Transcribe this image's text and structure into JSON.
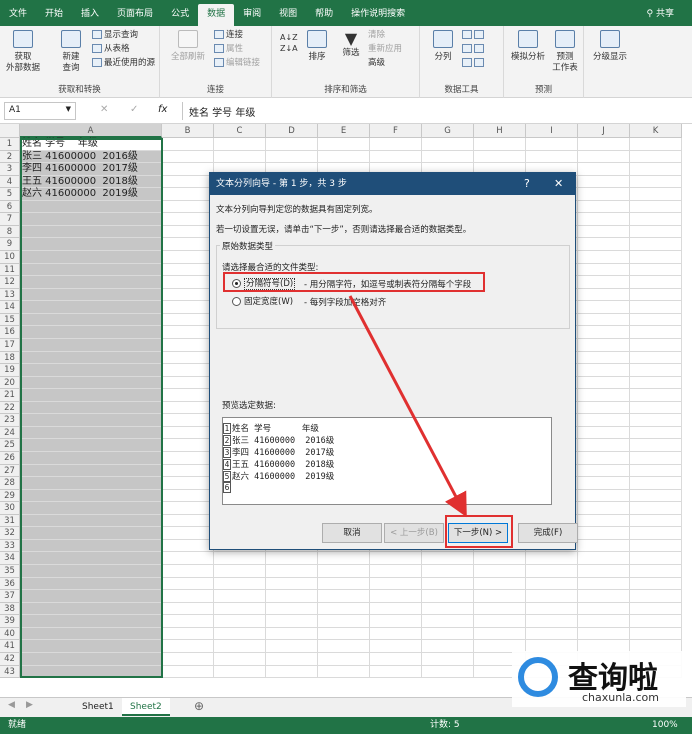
{
  "tabs": [
    "文件",
    "开始",
    "插入",
    "页面布局",
    "公式",
    "数据",
    "审阅",
    "视图",
    "帮助"
  ],
  "tell_me": "操作说明搜索",
  "share": "共享",
  "ribbon": {
    "get_external": "获取\n外部数据",
    "new_query": "新建\n查询",
    "show_query": "显示查询",
    "from_table": "从表格",
    "recent_sources": "最近使用的源",
    "group1": "获取和转换",
    "refresh_all": "全部刷新",
    "connections": "连接",
    "properties": "属性",
    "edit_links": "编辑链接",
    "group2": "连接",
    "sort": "排序",
    "filter": "筛选",
    "clear": "清除",
    "reapply": "重新应用",
    "advanced": "高级",
    "group3": "排序和筛选",
    "text_to_columns": "分列",
    "group4": "数据工具",
    "whatif": "模拟分析",
    "forecast": "预测\n工作表",
    "group5": "预测",
    "outline": "分级显示"
  },
  "formula_bar": {
    "name_box": "A1",
    "fx": "fx",
    "content": "姓名 学号    年级"
  },
  "columns": [
    "A",
    "B",
    "C",
    "D",
    "E",
    "F",
    "G",
    "H",
    "I",
    "J",
    "K"
  ],
  "cells": [
    "姓名 学号    年级",
    "张三 41600000  2016级",
    "李四 41600000  2017级",
    "王五 41600000  2018级",
    "赵六 41600000  2019级"
  ],
  "dialog": {
    "title": "文本分列向导 - 第 1 步，共 3 步",
    "help": "?",
    "close": "✕",
    "line1": "文本分列向导判定您的数据具有固定列宽。",
    "line2": "若一切设置无误，请单击“下一步”，否则请选择最合适的数据类型。",
    "section": "原始数据类型",
    "choose": "请选择最合适的文件类型:",
    "opt1": "分隔符号(D)",
    "opt1_desc": "- 用分隔字符，如逗号或制表符分隔每个字段",
    "opt2": "固定宽度(W)",
    "opt2_desc": "- 每列字段加空格对齐",
    "preview_label": "预览选定数据:",
    "preview": [
      "姓名 学号      年级",
      "张三 41600000  2016级",
      "李四 41600000  2017级",
      "王五 41600000  2018级",
      "赵六 41600000  2019级",
      ""
    ],
    "cancel": "取消",
    "back": "< 上一步(B)",
    "next": "下一步(N) >",
    "finish": "完成(F)"
  },
  "sheets": [
    "Sheet1",
    "Sheet2"
  ],
  "status": {
    "ready": "就绪",
    "count": "计数: 5",
    "zoom": "100%"
  },
  "watermark": {
    "brand": "查询啦",
    "url": "chaxunla.com"
  },
  "colors": {
    "excel_green": "#217346",
    "dialog_title": "#1f4e79",
    "highlight_red": "#e03030"
  }
}
